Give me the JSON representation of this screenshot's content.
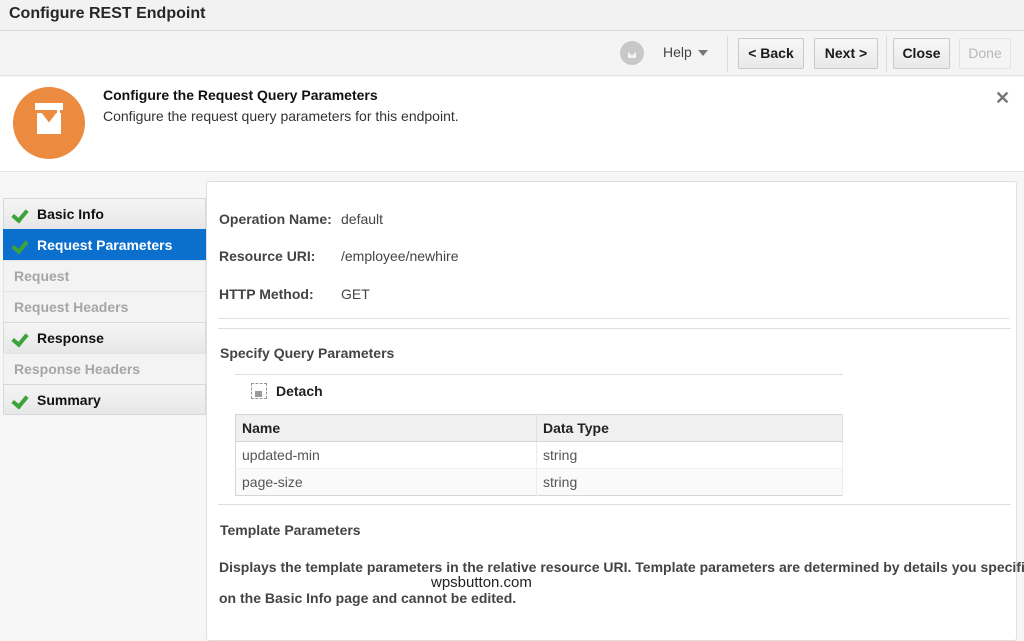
{
  "window": {
    "title": "Configure REST Endpoint"
  },
  "toolbar": {
    "help_label": "Help",
    "back_label": "< Back",
    "next_label": "Next >",
    "close_label": "Close",
    "done_label": "Done"
  },
  "header": {
    "title": "Configure the Request Query Parameters",
    "description": "Configure the request query parameters for this endpoint.",
    "close_glyph": "✕"
  },
  "nav": {
    "items": [
      {
        "label": "Basic Info",
        "completed": true,
        "state": "normal"
      },
      {
        "label": "Request Parameters",
        "completed": true,
        "state": "active"
      },
      {
        "label": "Request",
        "completed": false,
        "state": "disabled"
      },
      {
        "label": "Request Headers",
        "completed": false,
        "state": "disabled"
      },
      {
        "label": "Response",
        "completed": true,
        "state": "normal"
      },
      {
        "label": "Response Headers",
        "completed": false,
        "state": "disabled"
      },
      {
        "label": "Summary",
        "completed": true,
        "state": "normal"
      }
    ]
  },
  "details": {
    "operation_name_label": "Operation Name:",
    "operation_name_value": "default",
    "resource_uri_label": "Resource URI:",
    "resource_uri_value": "/employee/newhire",
    "http_method_label": "HTTP Method:",
    "http_method_value": "GET"
  },
  "query_params": {
    "section_title": "Specify Query Parameters",
    "detach_label": "Detach",
    "columns": [
      "Name",
      "Data Type"
    ],
    "rows": [
      {
        "name": "updated-min",
        "type": "string"
      },
      {
        "name": "page-size",
        "type": "string"
      }
    ]
  },
  "template_params": {
    "section_title": "Template Parameters",
    "description_line1": "Displays the template parameters in the relative resource URI. Template parameters are determined by details you specified",
    "description_line2": "on the Basic Info page and cannot be edited."
  },
  "watermark": "wpsbutton.com"
}
